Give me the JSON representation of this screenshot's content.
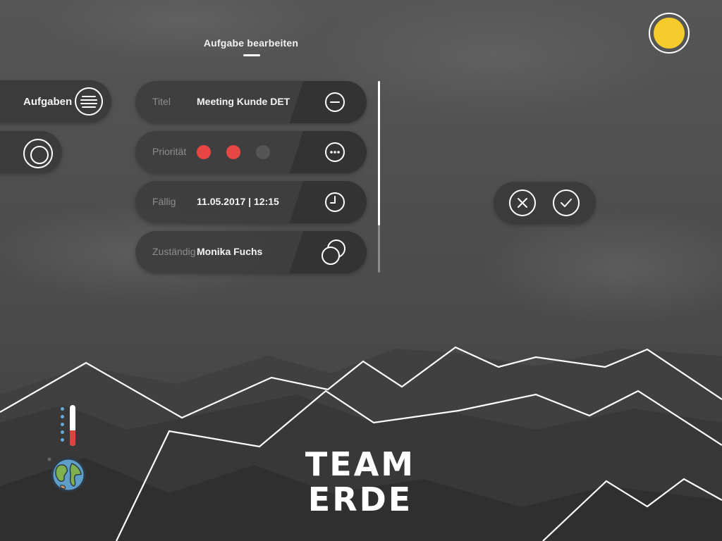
{
  "header": {
    "title": "Aufgabe bearbeiten"
  },
  "sidebar": {
    "tasks_label": "Aufgaben",
    "tasks_icon": "list-icon",
    "second_icon": "target-icon"
  },
  "weather": {
    "icon": "sun-icon",
    "color": "#f5cc2c"
  },
  "form": {
    "title": {
      "label": "Titel",
      "value": "Meeting Kunde DET",
      "icon": "minus-circle-icon"
    },
    "priority": {
      "label": "Priorität",
      "level": 2,
      "max": 3,
      "active_color": "#e84545",
      "inactive_color": "#555555",
      "icon": "more-circle-icon"
    },
    "due": {
      "label": "Fällig",
      "value": "11.05.2017 | 12:15",
      "icon": "clock-icon"
    },
    "assignee": {
      "label": "Zuständig",
      "value": "Monika Fuchs",
      "icon": "people-icon"
    }
  },
  "actions": {
    "cancel_icon": "close-icon",
    "confirm_icon": "check-icon"
  },
  "brand": {
    "line1": "TEAM",
    "line2": "ERDE"
  },
  "indicator": {
    "thermometer_level": 0.38,
    "globe_icon": "globe-icon"
  }
}
